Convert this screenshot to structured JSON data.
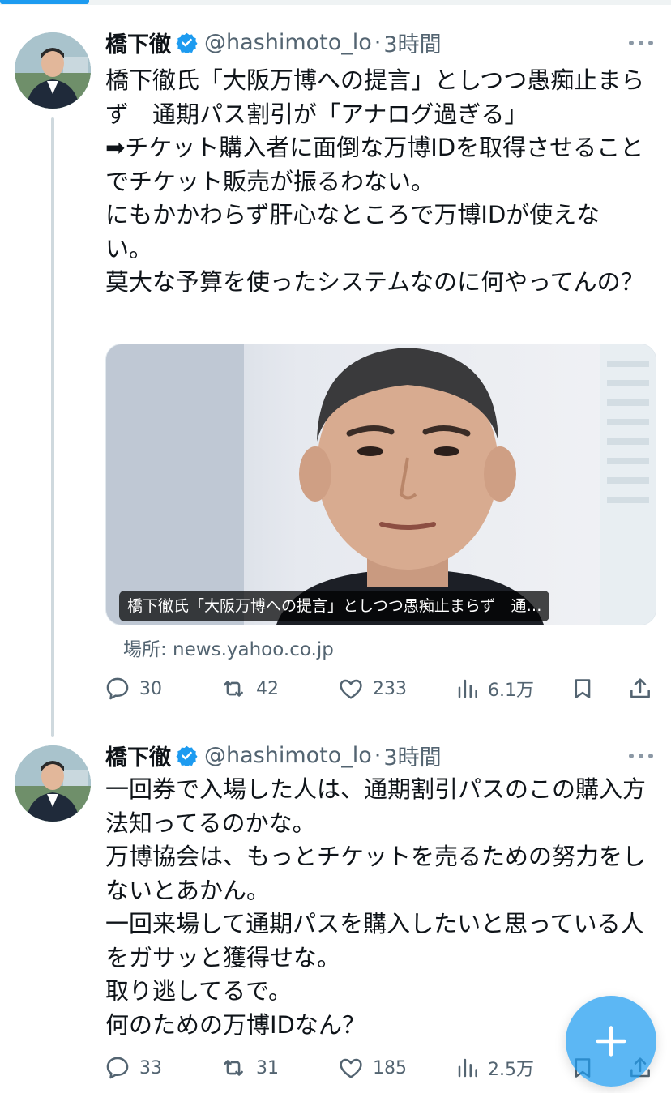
{
  "colors": {
    "accent": "#1d9bf0",
    "text_primary": "#0f1419",
    "text_secondary": "#536471",
    "thread_line": "#cfd9de"
  },
  "tweets": [
    {
      "display_name": "橋下徹",
      "verified_icon": "verified-badge-icon",
      "handle": "@hashimoto_lo",
      "dot": "·",
      "time": "3時間",
      "text": "橋下徹氏「大阪万博への提言」としつつ愚痴止まらず　通期パス割引が「アナログ過ぎる」\n➡チケット購入者に面倒な万博IDを取得させることでチケット販売が振るわない。\nにもかかわらず肝心なところで万博IDが使えない。\n莫大な予算を使ったシステムなのに何やってんの？",
      "card": {
        "caption": "橋下徹氏「大阪万博への提言」としつつ愚痴止まらず　通…",
        "source": "場所: news.yahoo.co.jp"
      },
      "actions": {
        "replies": "30",
        "reposts": "42",
        "likes": "233",
        "views": "6.1万"
      }
    },
    {
      "display_name": "橋下徹",
      "verified_icon": "verified-badge-icon",
      "handle": "@hashimoto_lo",
      "dot": "·",
      "time": "3時間",
      "text": "一回券で入場した人は、通期割引パスのこの購入方法知ってるのかな。\n万博協会は、もっとチケットを売るための努力をしないとあかん。\n一回来場して通期パスを購入したいと思っている人をガサッと獲得せな。\n取り逃してるで。\n何のための万博IDなん？",
      "actions": {
        "replies": "33",
        "reposts": "31",
        "likes": "185",
        "views": "2.5万"
      }
    }
  ],
  "fab": {
    "icon": "plus-icon"
  }
}
